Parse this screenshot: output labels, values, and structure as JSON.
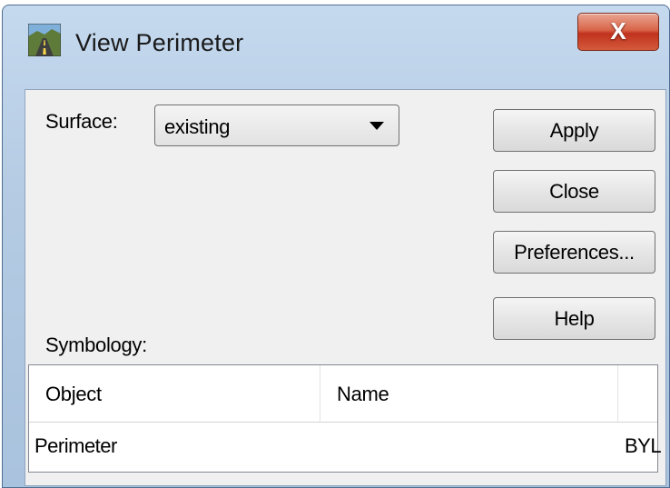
{
  "window": {
    "title": "View Perimeter",
    "close_label": "X"
  },
  "form": {
    "surface_label": "Surface:",
    "surface_value": "existing",
    "symbology_label": "Symbology:"
  },
  "buttons": {
    "apply": "Apply",
    "close": "Close",
    "preferences": "Preferences...",
    "help": "Help"
  },
  "table": {
    "columns": [
      "Object",
      "Name",
      ""
    ],
    "rows": [
      {
        "object": "Perimeter",
        "name": "",
        "third": "BYL"
      }
    ]
  },
  "colors": {
    "close_button": "#c0321d",
    "titlebar": "#b4cbe3",
    "client_background": "#f0f0f0"
  },
  "icons": {
    "title_icon": "road-icon",
    "dropdown_icon": "chevron-down-icon"
  }
}
